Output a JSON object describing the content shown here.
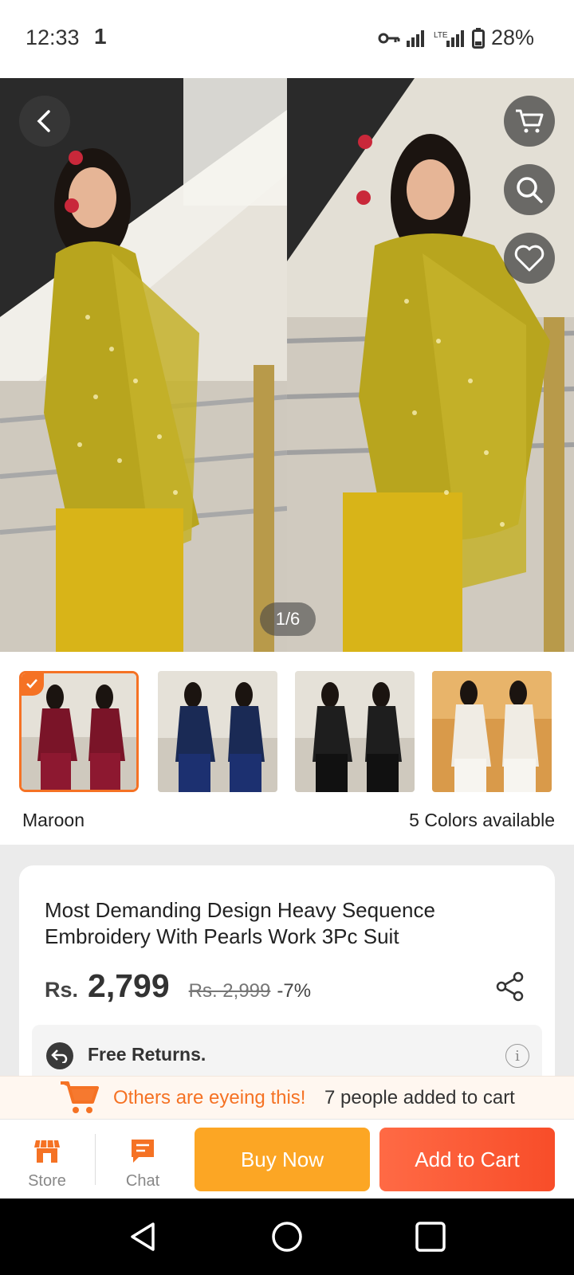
{
  "status_bar": {
    "time": "12:33",
    "indicator": "1",
    "battery": "28%",
    "icons": [
      "vpn-key-icon",
      "signal-icon",
      "lte-signal-icon",
      "battery-icon"
    ]
  },
  "hero": {
    "counter": "1/6",
    "buttons": [
      "back-arrow-icon",
      "cart-icon",
      "search-icon",
      "heart-icon"
    ]
  },
  "variants": {
    "items": [
      {
        "name": "Maroon",
        "color": "#7a1428",
        "selected": true
      },
      {
        "name": "",
        "color": "#1a2a55",
        "selected": false
      },
      {
        "name": "",
        "color": "#1e1e1e",
        "selected": false
      },
      {
        "name": "",
        "color": "#f0ece4",
        "selected": false
      }
    ],
    "selected_label": "Maroon",
    "count_label": "5 Colors available"
  },
  "product": {
    "title": "Most Demanding Design Heavy Sequence Embroidery With Pearls Work 3Pc Suit",
    "currency": "Rs.",
    "price": "2,799",
    "original_price": "Rs. 2,999",
    "discount": "-7%",
    "returns_label": "Free Returns.",
    "info_icon_label": "i"
  },
  "banner": {
    "highlight": "Others are eyeing this!",
    "text": "7 people added to cart"
  },
  "actions": {
    "store_label": "Store",
    "chat_label": "Chat",
    "buy_now_label": "Buy Now",
    "add_to_cart_label": "Add to Cart"
  },
  "colors": {
    "accent": "#f57224",
    "buy_now": "#fca624",
    "add_to_cart": "#f84d29",
    "outfit": "#b8a51e"
  }
}
